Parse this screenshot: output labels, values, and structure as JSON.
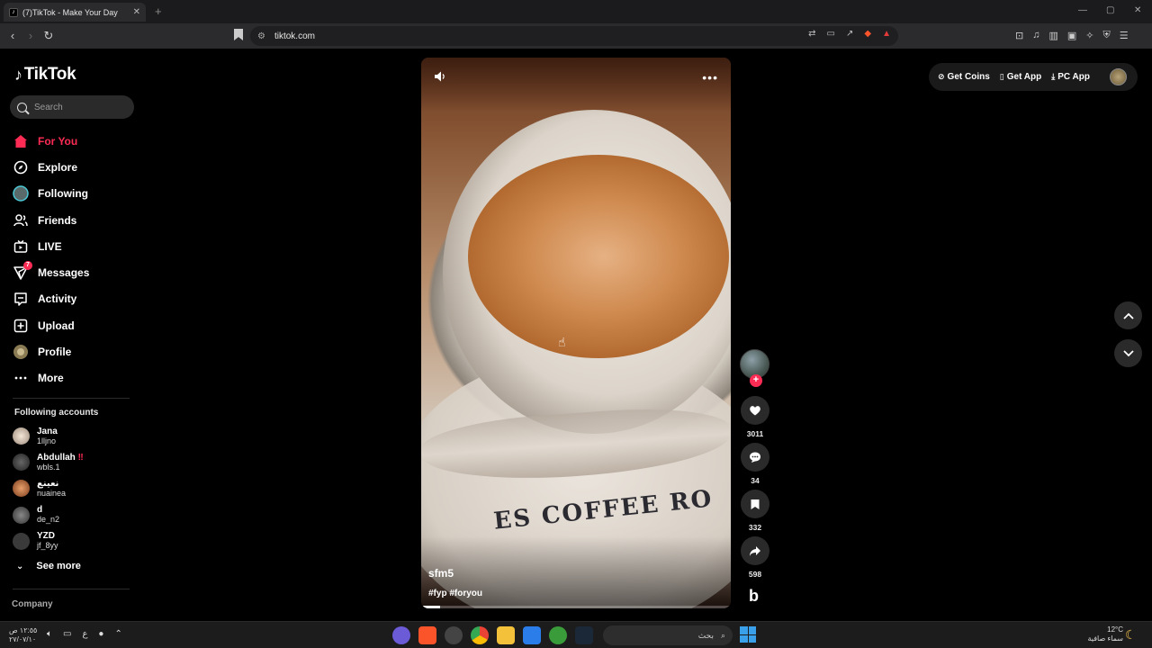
{
  "browser": {
    "tab_title": "(7)TikTok - Make Your Day",
    "tab_close": "✕",
    "new_tab": "+",
    "url": "tiktok.com",
    "win_min": "—",
    "win_max": "▢",
    "win_close": "✕"
  },
  "sidebar": {
    "logo": "TikTok",
    "search_placeholder": "Search",
    "nav": [
      {
        "label": "For You",
        "icon": "home-icon"
      },
      {
        "label": "Explore",
        "icon": "compass-icon"
      },
      {
        "label": "Following",
        "icon": "following-icon"
      },
      {
        "label": "Friends",
        "icon": "friends-icon"
      },
      {
        "label": "LIVE",
        "icon": "live-icon"
      },
      {
        "label": "Messages",
        "icon": "messages-icon",
        "badge": "7"
      },
      {
        "label": "Activity",
        "icon": "activity-icon"
      },
      {
        "label": "Upload",
        "icon": "upload-icon"
      },
      {
        "label": "Profile",
        "icon": "profile-icon"
      },
      {
        "label": "More",
        "icon": "more-icon"
      }
    ],
    "following_title": "Following accounts",
    "accounts": [
      {
        "name": "Jana",
        "username": "1lljno",
        "flag": ""
      },
      {
        "name": "Abdullah",
        "username": "wbls.1",
        "flag": "‼"
      },
      {
        "name": "نعينع",
        "username": "nuainea",
        "flag": ""
      },
      {
        "name": "d",
        "username": "de_n2",
        "flag": ""
      },
      {
        "name": "YZD",
        "username": "jf_8yy",
        "flag": ""
      }
    ],
    "see_more": "See more",
    "company": "Company"
  },
  "video": {
    "author": "sfm5",
    "tags": "#fyp #foryou",
    "saucer_text": "ES COFFEE RO",
    "progress": 0.06
  },
  "actions": {
    "likes": "3011",
    "comments": "34",
    "saves": "332",
    "shares": "598",
    "music_letter": "b"
  },
  "topbar": {
    "get_coins": "Get Coins",
    "get_app": "Get App",
    "pc_app": "PC App"
  },
  "taskbar": {
    "time": "١٢:٥٥ ص",
    "date": "٢٧/٠٧/١٠",
    "search": "بحث",
    "lang": "ع",
    "temp": "12°C",
    "weather": "سماء صافية"
  },
  "colors": {
    "accent": "#fe2c55",
    "background": "#000000"
  }
}
